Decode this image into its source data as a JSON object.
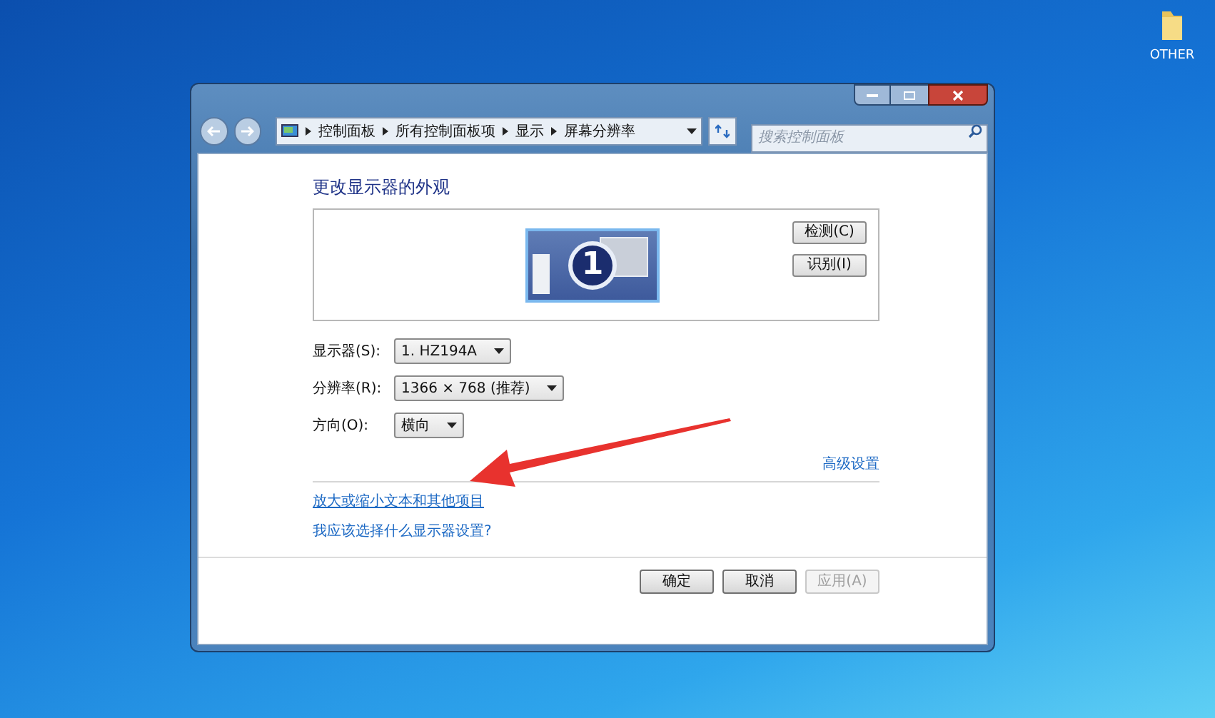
{
  "desktop_icons": [
    {
      "label": "OTHER"
    }
  ],
  "window": {
    "breadcrumb": [
      "控制面板",
      "所有控制面板项",
      "显示",
      "屏幕分辨率"
    ],
    "search": {
      "placeholder": "搜索控制面板"
    },
    "heading": "更改显示器的外观",
    "monitor_badge": "1",
    "monitor_buttons": [
      "检测(C)",
      "识别(I)"
    ],
    "fields": [
      {
        "label": "显示器(S):",
        "value": "1. HZ194A"
      },
      {
        "label": "分辨率(R):",
        "value": "1366 × 768 (推荐)"
      },
      {
        "label": "方向(O):",
        "value": "横向"
      }
    ],
    "advanced_link": "高级设置",
    "links": [
      "放大或缩小文本和其他项目",
      "我应该选择什么显示器设置?"
    ],
    "buttons": [
      {
        "label": "确定",
        "disabled": false
      },
      {
        "label": "取消",
        "disabled": false
      },
      {
        "label": "应用(A)",
        "disabled": true
      }
    ]
  }
}
